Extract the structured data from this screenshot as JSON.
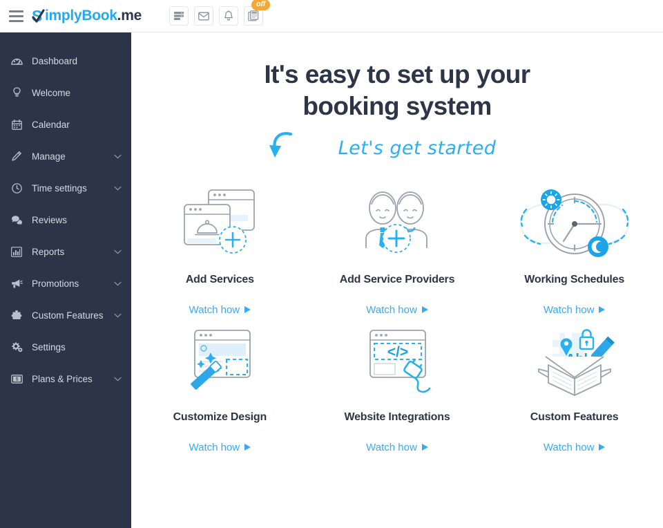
{
  "brand": {
    "name_blue": "implyBook",
    "name_dark": ".me",
    "accent_blue": "#26a8ec",
    "dark_navy": "#2d3548",
    "link_blue": "#3aa9f5",
    "badge_orange": "#f7a733",
    "sidebar_bg": "#2c3447"
  },
  "topbar": {
    "menu_icon": "hamburger-icon",
    "actions": [
      {
        "icon": "server-list-icon",
        "label": ""
      },
      {
        "icon": "envelope-icon",
        "label": ""
      },
      {
        "icon": "bell-icon",
        "label": ""
      },
      {
        "icon": "news-clipboard-icon",
        "label": "",
        "badge": "off"
      }
    ]
  },
  "sidebar": {
    "items": [
      {
        "label": "Dashboard",
        "icon": "dashboard-gauge-icon",
        "expandable": false
      },
      {
        "label": "Welcome",
        "icon": "lightbulb-icon",
        "expandable": false
      },
      {
        "label": "Calendar",
        "icon": "calendar-icon",
        "expandable": false
      },
      {
        "label": "Manage",
        "icon": "pencil-icon",
        "expandable": true
      },
      {
        "label": "Time settings",
        "icon": "clock-icon",
        "expandable": true
      },
      {
        "label": "Reviews",
        "icon": "chat-bubbles-icon",
        "expandable": false
      },
      {
        "label": "Reports",
        "icon": "bar-chart-icon",
        "expandable": true
      },
      {
        "label": "Promotions",
        "icon": "megaphone-icon",
        "expandable": true
      },
      {
        "label": "Custom Features",
        "icon": "puzzle-icon",
        "expandable": true
      },
      {
        "label": "Settings",
        "icon": "gears-icon",
        "expandable": false
      },
      {
        "label": "Plans & Prices",
        "icon": "banknote-icon",
        "expandable": true
      }
    ]
  },
  "main": {
    "headline_line1": "It's easy to set up your",
    "headline_line2": "booking system",
    "subline": "Let's get started",
    "cards": [
      {
        "title": "Add Services",
        "link": "Watch how",
        "art": "services-windows-plus-icon"
      },
      {
        "title": "Add Service Providers",
        "link": "Watch how",
        "art": "two-people-plus-icon"
      },
      {
        "title": "Working Schedules",
        "link": "Watch how",
        "art": "clock-sun-moon-icon"
      },
      {
        "title": "Customize Design",
        "link": "Watch how",
        "art": "magic-wand-window-icon"
      },
      {
        "title": "Website Integrations",
        "link": "Watch how",
        "art": "code-plug-window-icon"
      },
      {
        "title": "Custom Features",
        "link": "Watch how",
        "art": "open-box-tools-icon"
      }
    ]
  }
}
